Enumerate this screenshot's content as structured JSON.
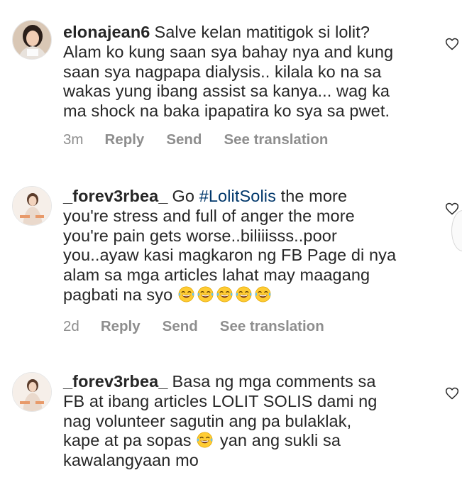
{
  "comments": [
    {
      "username": "elonajean6",
      "text": "Salve kelan matitigok si lolit? Alam ko kung saan sya bahay nya and kung saan sya nagpapa dialysis.. kilala ko na sa wakas yung ibang assist sa kanya... wag ka ma shock na baka ipapatira ko sya sa pwet.",
      "lines": [
        "Salve kelan matitigok si lolit?",
        "Alam ko kung saan sya bahay nya and kung",
        "saan sya nagpapa dialysis.. kilala ko na sa",
        "wakas yung ibang assist sa kanya... wag ka",
        "ma shock na baka ipapatira ko sya sa pwet."
      ],
      "time": "3m",
      "reply_label": "Reply",
      "send_label": "Send",
      "translation_label": "See translation"
    },
    {
      "username": "_forev3rbea_",
      "text_before_hashtag": "Go",
      "hashtag": "#LolitSolis",
      "text_after_hashtag": "the more",
      "lines": [
        "you're stress and full of anger the more",
        "you're pain gets worse..biliiisss..poor",
        "you..ayaw kasi magkaron ng FB Page di nya",
        "alam sa mga articles lahat may maagang",
        "pagbati na syo"
      ],
      "emoji_count": 5,
      "emoji_name": "laughing-tears-emoji",
      "time": "2d",
      "reply_label": "Reply",
      "send_label": "Send",
      "translation_label": "See translation"
    },
    {
      "username": "_forev3rbea_",
      "first_line": "Basa ng mga comments sa",
      "lines": [
        "FB at ibang articles LOLIT SOLIS dami ng",
        "nag volunteer sagutin ang pa bulaklak,"
      ],
      "line_before_emoji": "kape at pa sopas",
      "line_after_emoji": "yan ang sukli sa",
      "last_line": "kawalangyaan mo"
    }
  ],
  "icons": {
    "like": "heart-outline-icon",
    "scroll": "scroll-right-arrow"
  },
  "colors": {
    "text": "#262626",
    "meta": "#8e8e8e",
    "hashtag": "#00376b"
  }
}
